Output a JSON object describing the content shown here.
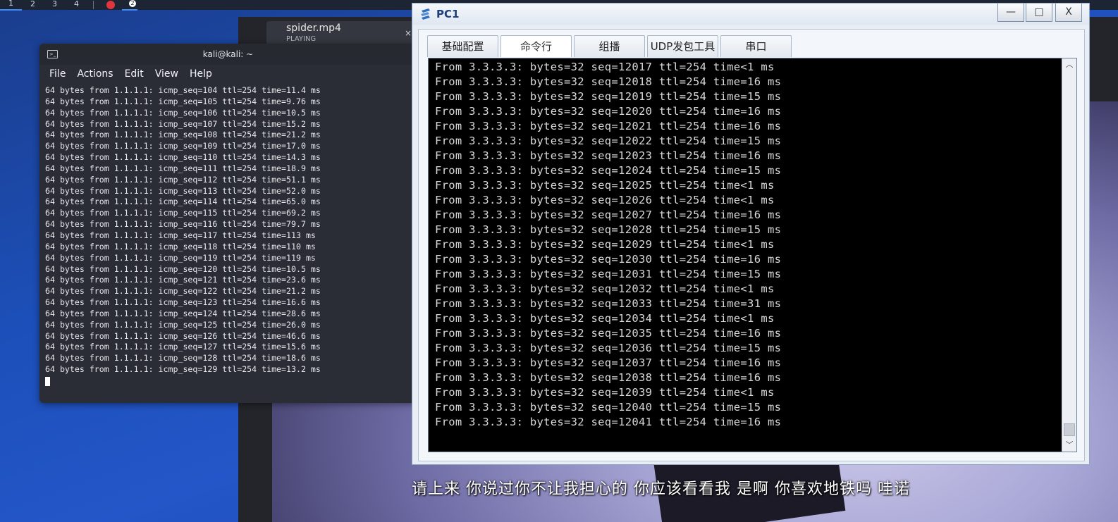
{
  "taskbar": {
    "workspaces": [
      "1",
      "2",
      "3",
      "4"
    ],
    "badge": "2"
  },
  "video": {
    "title": "spider.mp4",
    "status": "PLAYING",
    "close": "×",
    "subtitle": "请上来  你说过你不让我担心的  你应该看看我  是啊  你喜欢地铁吗  哇诺"
  },
  "terminal": {
    "title": "kali@kali: ~",
    "menu": [
      "File",
      "Actions",
      "Edit",
      "View",
      "Help"
    ],
    "lines": [
      "64 bytes from 1.1.1.1: icmp_seq=104 ttl=254 time=11.4 ms",
      "64 bytes from 1.1.1.1: icmp_seq=105 ttl=254 time=9.76 ms",
      "64 bytes from 1.1.1.1: icmp_seq=106 ttl=254 time=10.5 ms",
      "64 bytes from 1.1.1.1: icmp_seq=107 ttl=254 time=15.2 ms",
      "64 bytes from 1.1.1.1: icmp_seq=108 ttl=254 time=21.2 ms",
      "64 bytes from 1.1.1.1: icmp_seq=109 ttl=254 time=17.0 ms",
      "64 bytes from 1.1.1.1: icmp_seq=110 ttl=254 time=14.3 ms",
      "64 bytes from 1.1.1.1: icmp_seq=111 ttl=254 time=18.9 ms",
      "64 bytes from 1.1.1.1: icmp_seq=112 ttl=254 time=51.1 ms",
      "64 bytes from 1.1.1.1: icmp_seq=113 ttl=254 time=52.0 ms",
      "64 bytes from 1.1.1.1: icmp_seq=114 ttl=254 time=65.0 ms",
      "64 bytes from 1.1.1.1: icmp_seq=115 ttl=254 time=69.2 ms",
      "64 bytes from 1.1.1.1: icmp_seq=116 ttl=254 time=79.7 ms",
      "64 bytes from 1.1.1.1: icmp_seq=117 ttl=254 time=113 ms",
      "64 bytes from 1.1.1.1: icmp_seq=118 ttl=254 time=110 ms",
      "64 bytes from 1.1.1.1: icmp_seq=119 ttl=254 time=119 ms",
      "64 bytes from 1.1.1.1: icmp_seq=120 ttl=254 time=10.5 ms",
      "64 bytes from 1.1.1.1: icmp_seq=121 ttl=254 time=23.6 ms",
      "64 bytes from 1.1.1.1: icmp_seq=122 ttl=254 time=21.2 ms",
      "64 bytes from 1.1.1.1: icmp_seq=123 ttl=254 time=16.6 ms",
      "64 bytes from 1.1.1.1: icmp_seq=124 ttl=254 time=28.6 ms",
      "64 bytes from 1.1.1.1: icmp_seq=125 ttl=254 time=26.0 ms",
      "64 bytes from 1.1.1.1: icmp_seq=126 ttl=254 time=46.6 ms",
      "64 bytes from 1.1.1.1: icmp_seq=127 ttl=254 time=15.6 ms",
      "64 bytes from 1.1.1.1: icmp_seq=128 ttl=254 time=18.6 ms",
      "64 bytes from 1.1.1.1: icmp_seq=129 ttl=254 time=13.2 ms"
    ]
  },
  "pc1": {
    "title": "PC1",
    "buttons": {
      "minimize": "—",
      "maximize": "□",
      "close": "X"
    },
    "tabs": [
      "基础配置",
      "命令行",
      "组播",
      "UDP发包工具",
      "串口"
    ],
    "active_tab": "命令行",
    "lines": [
      "From 3.3.3.3: bytes=32 seq=12017 ttl=254 time<1 ms",
      "From 3.3.3.3: bytes=32 seq=12018 ttl=254 time=16 ms",
      "From 3.3.3.3: bytes=32 seq=12019 ttl=254 time=15 ms",
      "From 3.3.3.3: bytes=32 seq=12020 ttl=254 time=16 ms",
      "From 3.3.3.3: bytes=32 seq=12021 ttl=254 time=16 ms",
      "From 3.3.3.3: bytes=32 seq=12022 ttl=254 time=15 ms",
      "From 3.3.3.3: bytes=32 seq=12023 ttl=254 time=16 ms",
      "From 3.3.3.3: bytes=32 seq=12024 ttl=254 time=15 ms",
      "From 3.3.3.3: bytes=32 seq=12025 ttl=254 time<1 ms",
      "From 3.3.3.3: bytes=32 seq=12026 ttl=254 time<1 ms",
      "From 3.3.3.3: bytes=32 seq=12027 ttl=254 time=16 ms",
      "From 3.3.3.3: bytes=32 seq=12028 ttl=254 time=15 ms",
      "From 3.3.3.3: bytes=32 seq=12029 ttl=254 time<1 ms",
      "From 3.3.3.3: bytes=32 seq=12030 ttl=254 time=16 ms",
      "From 3.3.3.3: bytes=32 seq=12031 ttl=254 time=15 ms",
      "From 3.3.3.3: bytes=32 seq=12032 ttl=254 time<1 ms",
      "From 3.3.3.3: bytes=32 seq=12033 ttl=254 time=31 ms",
      "From 3.3.3.3: bytes=32 seq=12034 ttl=254 time<1 ms",
      "From 3.3.3.3: bytes=32 seq=12035 ttl=254 time=16 ms",
      "From 3.3.3.3: bytes=32 seq=12036 ttl=254 time=15 ms",
      "From 3.3.3.3: bytes=32 seq=12037 ttl=254 time=16 ms",
      "From 3.3.3.3: bytes=32 seq=12038 ttl=254 time=16 ms",
      "From 3.3.3.3: bytes=32 seq=12039 ttl=254 time<1 ms",
      "From 3.3.3.3: bytes=32 seq=12040 ttl=254 time=15 ms",
      "From 3.3.3.3: bytes=32 seq=12041 ttl=254 time=16 ms"
    ]
  }
}
